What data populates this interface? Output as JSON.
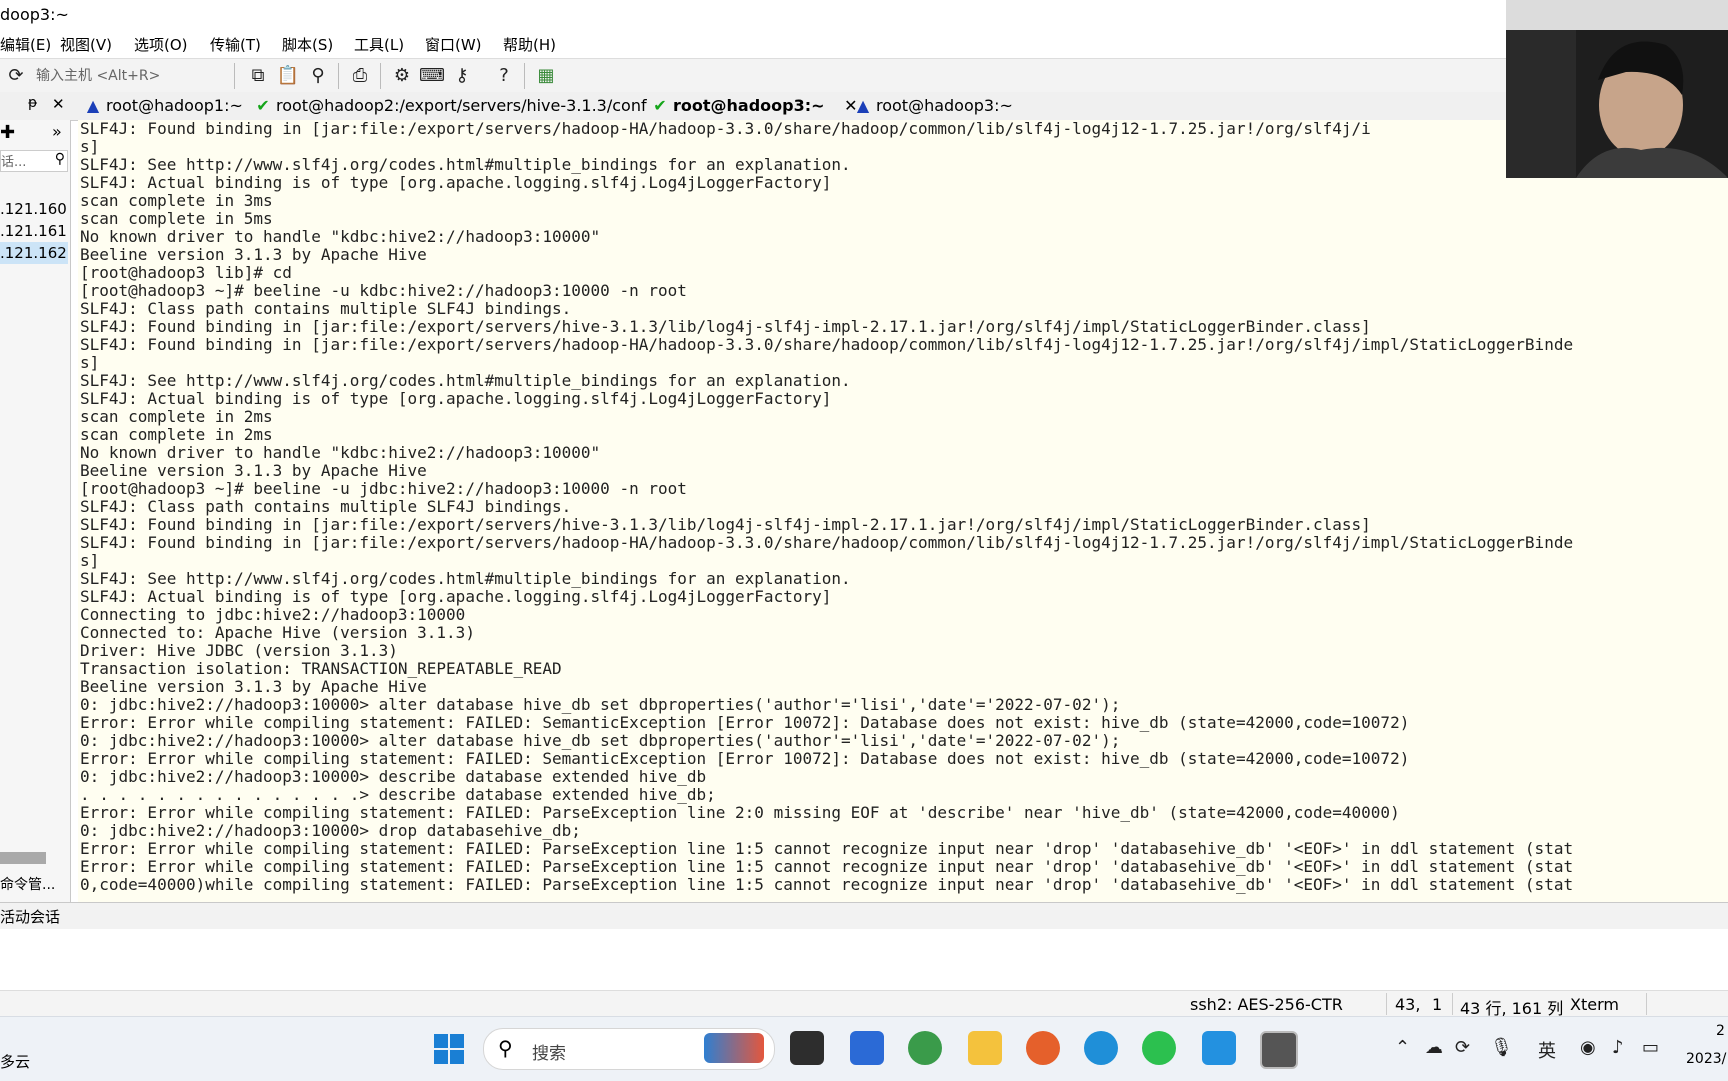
{
  "window": {
    "title": "doop3:~"
  },
  "menu": [
    "编辑(E)",
    "视图(V)",
    "选项(O)",
    "传输(T)",
    "脚本(S)",
    "工具(L)",
    "窗口(W)",
    "帮助(H)"
  ],
  "toolbar": {
    "host_placeholder": "输入主机 <Alt+R>"
  },
  "tabs": [
    {
      "label": "root@hadoop1:~",
      "status": "warning",
      "active": false
    },
    {
      "label": "root@hadoop2:/export/servers/hive-3.1.3/conf",
      "status": "ok",
      "active": false
    },
    {
      "label": "root@hadoop3:~",
      "status": "ok",
      "active": true,
      "close": "✕"
    },
    {
      "label": "root@hadoop3:~",
      "status": "warning",
      "active": false
    }
  ],
  "sidebar": {
    "pin": "ᵽ",
    "close": "✕",
    "add": "✚",
    "more": "»",
    "filter_placeholder": "话...",
    "items": [
      ".121.160",
      ".121.161",
      ".121.162"
    ],
    "cmd_label": "命令管...",
    "selected_index": 2
  },
  "terminal": {
    "lines": [
      "SLF4J: Found binding in [jar:file:/export/servers/hadoop-HA/hadoop-3.3.0/share/hadoop/common/lib/slf4j-log4j12-1.7.25.jar!/org/slf4j/i",
      "s]",
      "SLF4J: See http://www.slf4j.org/codes.html#multiple_bindings for an explanation.",
      "SLF4J: Actual binding is of type [org.apache.logging.slf4j.Log4jLoggerFactory]",
      "scan complete in 3ms",
      "scan complete in 5ms",
      "No known driver to handle \"kdbc:hive2://hadoop3:10000\"",
      "Beeline version 3.1.3 by Apache Hive",
      "[root@hadoop3 lib]# cd",
      "[root@hadoop3 ~]# beeline -u kdbc:hive2://hadoop3:10000 -n root",
      "SLF4J: Class path contains multiple SLF4J bindings.",
      "SLF4J: Found binding in [jar:file:/export/servers/hive-3.1.3/lib/log4j-slf4j-impl-2.17.1.jar!/org/slf4j/impl/StaticLoggerBinder.class]",
      "SLF4J: Found binding in [jar:file:/export/servers/hadoop-HA/hadoop-3.3.0/share/hadoop/common/lib/slf4j-log4j12-1.7.25.jar!/org/slf4j/impl/StaticLoggerBinde",
      "s]",
      "SLF4J: See http://www.slf4j.org/codes.html#multiple_bindings for an explanation.",
      "SLF4J: Actual binding is of type [org.apache.logging.slf4j.Log4jLoggerFactory]",
      "scan complete in 2ms",
      "scan complete in 2ms",
      "No known driver to handle \"kdbc:hive2://hadoop3:10000\"",
      "Beeline version 3.1.3 by Apache Hive",
      "[root@hadoop3 ~]# beeline -u jdbc:hive2://hadoop3:10000 -n root",
      "SLF4J: Class path contains multiple SLF4J bindings.",
      "SLF4J: Found binding in [jar:file:/export/servers/hive-3.1.3/lib/log4j-slf4j-impl-2.17.1.jar!/org/slf4j/impl/StaticLoggerBinder.class]",
      "SLF4J: Found binding in [jar:file:/export/servers/hadoop-HA/hadoop-3.3.0/share/hadoop/common/lib/slf4j-log4j12-1.7.25.jar!/org/slf4j/impl/StaticLoggerBinde",
      "s]",
      "SLF4J: See http://www.slf4j.org/codes.html#multiple_bindings for an explanation.",
      "SLF4J: Actual binding is of type [org.apache.logging.slf4j.Log4jLoggerFactory]",
      "Connecting to jdbc:hive2://hadoop3:10000",
      "Connected to: Apache Hive (version 3.1.3)",
      "Driver: Hive JDBC (version 3.1.3)",
      "Transaction isolation: TRANSACTION_REPEATABLE_READ",
      "Beeline version 3.1.3 by Apache Hive",
      "0: jdbc:hive2://hadoop3:10000> alter database hive_db set dbproperties('author'='lisi','date'='2022-07-02');",
      "Error: Error while compiling statement: FAILED: SemanticException [Error 10072]: Database does not exist: hive_db (state=42000,code=10072)",
      "0: jdbc:hive2://hadoop3:10000> alter database hive_db set dbproperties('author'='lisi','date'='2022-07-02');",
      "Error: Error while compiling statement: FAILED: SemanticException [Error 10072]: Database does not exist: hive_db (state=42000,code=10072)",
      "0: jdbc:hive2://hadoop3:10000> describe database extended hive_db",
      ". . . . . . . . . . . . . . .> describe database extended hive_db;",
      "Error: Error while compiling statement: FAILED: ParseException line 2:0 missing EOF at 'describe' near 'hive_db' (state=42000,code=40000)",
      "0: jdbc:hive2://hadoop3:10000> drop databasehive_db;",
      "Error: Error while compiling statement: FAILED: ParseException line 1:5 cannot recognize input near 'drop' 'databasehive_db' '<EOF>' in ddl statement (stat",
      "Error: Error while compiling statement: FAILED: ParseException line 1:5 cannot recognize input near 'drop' 'databasehive_db' '<EOF>' in ddl statement (stat",
      "0,code=40000)while compiling statement: FAILED: ParseException line 1:5 cannot recognize input near 'drop' 'databasehive_db' '<EOF>' in ddl statement (stat"
    ]
  },
  "session_bar": {
    "label": "活动会话"
  },
  "statusbar": {
    "cipher": "ssh2: AES-256-CTR",
    "row": "43,",
    "col": "1",
    "size": "43 行, 161 列",
    "term": "Xterm"
  },
  "taskbar": {
    "left_text": "多云",
    "search_placeholder": "搜索",
    "ime": "英",
    "clock": "2",
    "date": "2023/"
  }
}
